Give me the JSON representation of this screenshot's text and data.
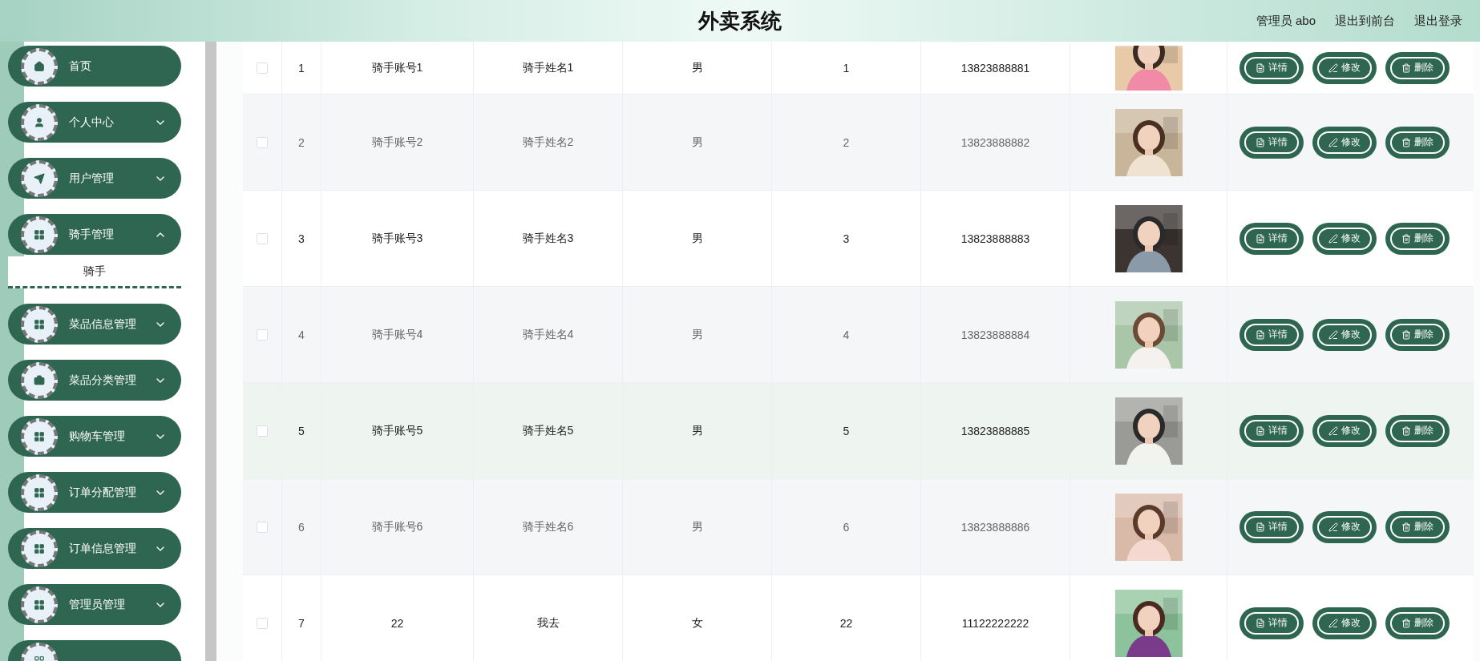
{
  "header": {
    "title": "外卖系统",
    "user": "管理员 abo",
    "links": [
      "退出到前台",
      "退出登录"
    ]
  },
  "sidebar": {
    "items": [
      {
        "label": "首页",
        "kind": "link"
      },
      {
        "label": "个人中心",
        "kind": "menu",
        "expanded": false
      },
      {
        "label": "用户管理",
        "kind": "menu",
        "expanded": false
      },
      {
        "label": "骑手管理",
        "kind": "menu",
        "expanded": true,
        "children": [
          {
            "label": "骑手",
            "selected": true
          }
        ]
      },
      {
        "label": "菜品信息管理",
        "kind": "menu",
        "expanded": false
      },
      {
        "label": "菜品分类管理",
        "kind": "menu",
        "expanded": false
      },
      {
        "label": "购物车管理",
        "kind": "menu",
        "expanded": false
      },
      {
        "label": "订单分配管理",
        "kind": "menu",
        "expanded": false
      },
      {
        "label": "订单信息管理",
        "kind": "menu",
        "expanded": false
      },
      {
        "label": "管理员管理",
        "kind": "menu",
        "expanded": false
      }
    ]
  },
  "table": {
    "rows": [
      {
        "checked": false,
        "hovered": false,
        "index": "1",
        "account": "骑手账号1",
        "name": "骑手姓名1",
        "gender": "男",
        "number": "1",
        "phone": "13823888881",
        "actions": [
          {
            "kind": "detail",
            "label": "详情"
          },
          {
            "kind": "edit",
            "label": "修改"
          },
          {
            "kind": "delete",
            "label": "删除"
          }
        ]
      },
      {
        "checked": false,
        "hovered": false,
        "index": "2",
        "account": "骑手账号2",
        "name": "骑手姓名2",
        "gender": "男",
        "number": "2",
        "phone": "13823888882",
        "actions": [
          {
            "kind": "detail",
            "label": "详情"
          },
          {
            "kind": "edit",
            "label": "修改"
          },
          {
            "kind": "delete",
            "label": "删除"
          }
        ]
      },
      {
        "checked": false,
        "hovered": false,
        "index": "3",
        "account": "骑手账号3",
        "name": "骑手姓名3",
        "gender": "男",
        "number": "3",
        "phone": "13823888883",
        "actions": [
          {
            "kind": "detail",
            "label": "详情"
          },
          {
            "kind": "edit",
            "label": "修改"
          },
          {
            "kind": "delete",
            "label": "删除"
          }
        ]
      },
      {
        "checked": false,
        "hovered": false,
        "index": "4",
        "account": "骑手账号4",
        "name": "骑手姓名4",
        "gender": "男",
        "number": "4",
        "phone": "13823888884",
        "actions": [
          {
            "kind": "detail",
            "label": "详情"
          },
          {
            "kind": "edit",
            "label": "修改"
          },
          {
            "kind": "delete",
            "label": "删除"
          }
        ]
      },
      {
        "checked": false,
        "hovered": true,
        "index": "5",
        "account": "骑手账号5",
        "name": "骑手姓名5",
        "gender": "男",
        "number": "5",
        "phone": "13823888885",
        "actions": [
          {
            "kind": "detail",
            "label": "详情"
          },
          {
            "kind": "edit",
            "label": "修改"
          },
          {
            "kind": "delete",
            "label": "删除"
          }
        ]
      },
      {
        "checked": false,
        "hovered": false,
        "index": "6",
        "account": "骑手账号6",
        "name": "骑手姓名6",
        "gender": "男",
        "number": "6",
        "phone": "13823888886",
        "actions": [
          {
            "kind": "detail",
            "label": "详情"
          },
          {
            "kind": "edit",
            "label": "修改"
          },
          {
            "kind": "delete",
            "label": "删除"
          }
        ]
      },
      {
        "checked": false,
        "hovered": false,
        "index": "7",
        "account": "22",
        "name": "我去",
        "gender": "女",
        "number": "22",
        "phone": "11122222222",
        "actions": [
          {
            "kind": "detail",
            "label": "详情"
          },
          {
            "kind": "edit",
            "label": "修改"
          },
          {
            "kind": "delete",
            "label": "删除"
          }
        ]
      }
    ]
  }
}
